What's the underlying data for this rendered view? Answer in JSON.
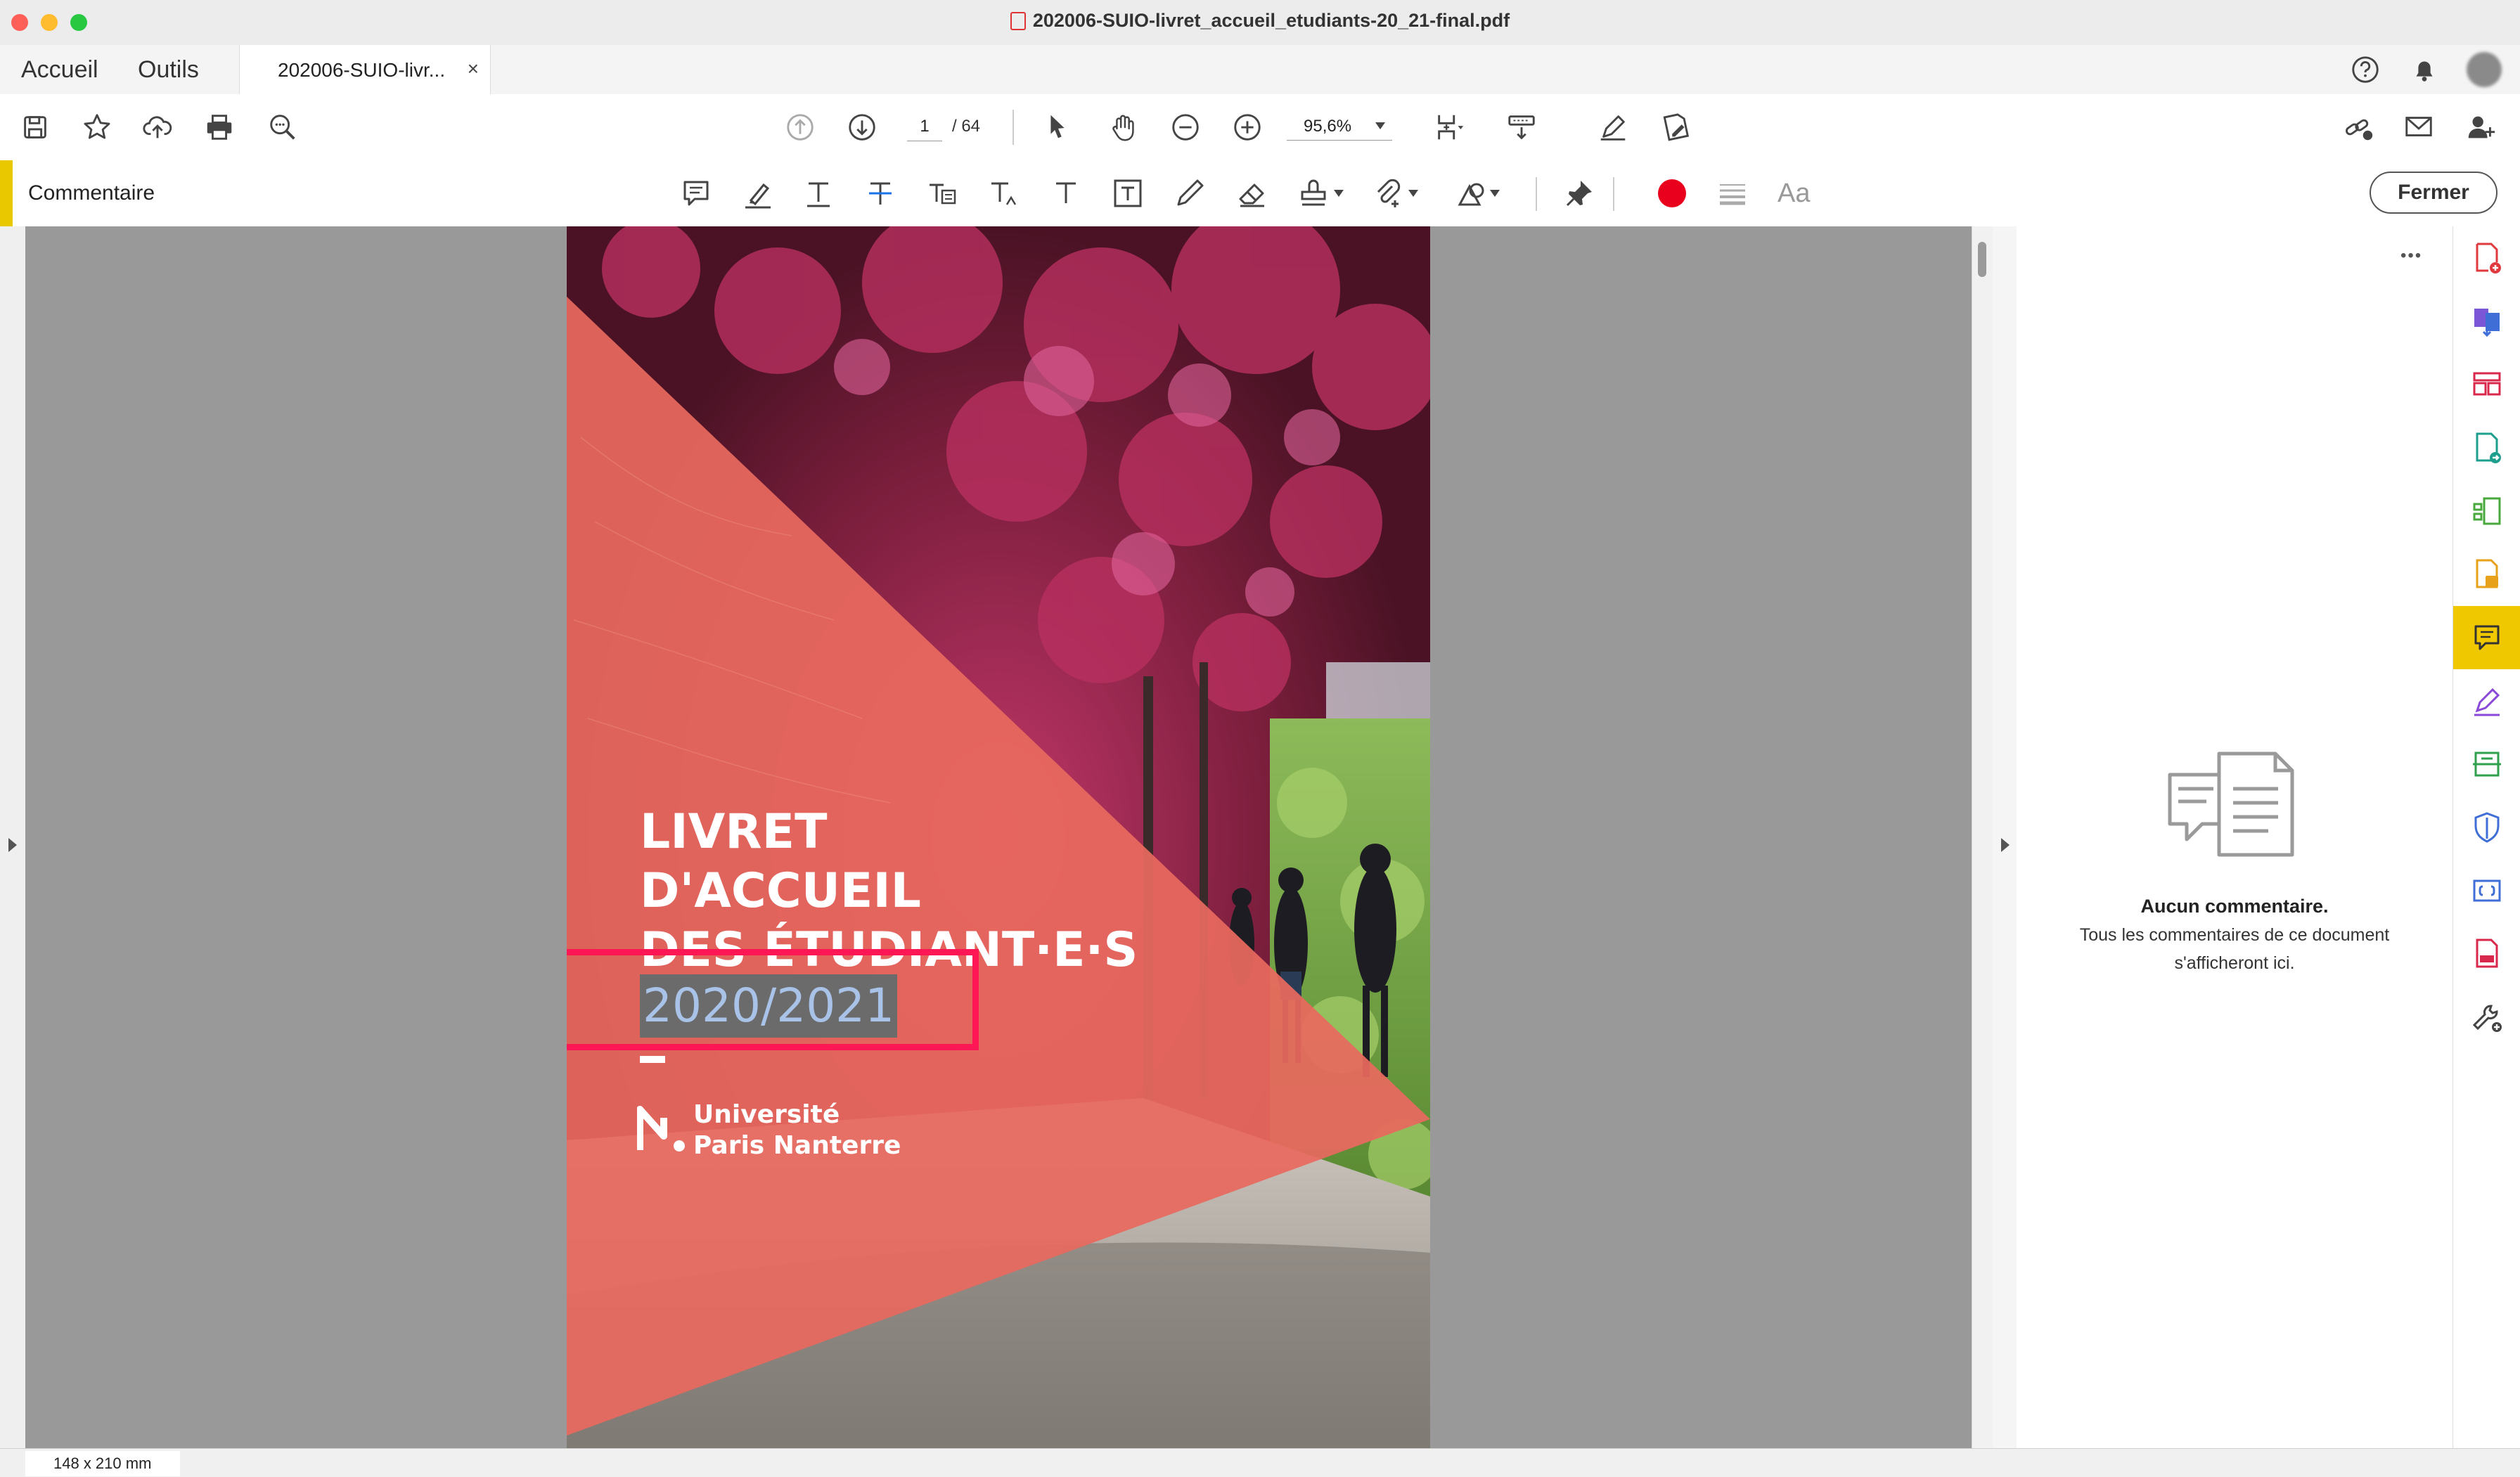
{
  "window": {
    "title": "202006-SUIO-livret_accueil_etudiants-20_21-final.pdf"
  },
  "tabs": {
    "home": "Accueil",
    "tools": "Outils",
    "document": "202006-SUIO-livr...",
    "close_symbol": "×"
  },
  "toolbar": {
    "page_current": "1",
    "page_total": "/ 64",
    "zoom": "95,6%"
  },
  "comment_bar": {
    "label": "Commentaire",
    "close_label": "Fermer",
    "font_label": "Aa",
    "color": "#e8001c"
  },
  "document": {
    "title_lines": [
      "LIVRET",
      "D'ACCUEIL",
      "DES ÉTUDIANT·E·S"
    ],
    "year": "2020/2021",
    "university_line1": "Université",
    "university_line2": "Paris Nanterre",
    "highlight_color": "#ff1654",
    "triangle_color": "#e8695f"
  },
  "comments_panel": {
    "more": "•••",
    "empty_title": "Aucun commentaire.",
    "empty_line1": "Tous les commentaires de ce document",
    "empty_line2": "s'afficheront ici."
  },
  "status": {
    "page_size": "148 x 210 mm"
  },
  "icons": {
    "toolbar": [
      "save-icon",
      "star-icon",
      "upload-cloud-icon",
      "print-icon",
      "find-icon",
      "page-up-icon",
      "page-down-icon",
      "select-arrow-icon",
      "hand-icon",
      "zoom-out-icon",
      "zoom-in-icon",
      "fit-page-icon",
      "scroll-mode-icon",
      "sign-icon",
      "edit-pdf-icon",
      "share-link-icon",
      "mail-icon",
      "add-user-icon"
    ],
    "comment_tools": [
      "sticky-note-icon",
      "highlight-icon",
      "underline-text-icon",
      "strikethrough-icon",
      "replace-text-icon",
      "insert-text-icon",
      "text-comment-icon",
      "text-box-icon",
      "pencil-icon",
      "eraser-icon",
      "stamp-icon",
      "attach-icon",
      "shapes-icon",
      "pin-icon",
      "color-dot-icon",
      "line-weight-icon"
    ],
    "right_rail": [
      "create-pdf-icon",
      "combine-icon",
      "organize-pages-icon",
      "export-pdf-icon",
      "compress-icon",
      "edit-doc-icon",
      "comment-icon",
      "fill-sign-icon",
      "scan-icon",
      "protect-icon",
      "redact-icon",
      "print-production-icon",
      "more-tools-icon"
    ]
  }
}
